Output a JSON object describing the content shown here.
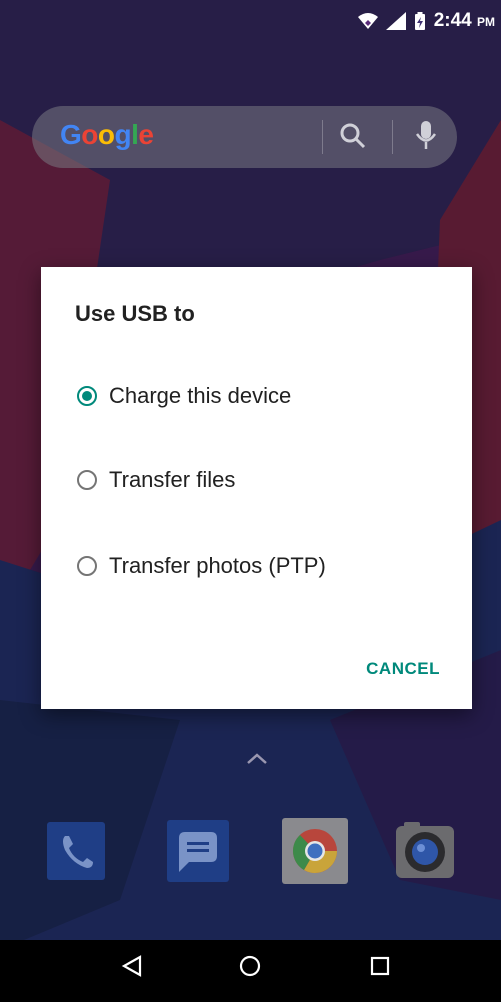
{
  "status_bar": {
    "time": "2:44",
    "ampm": "PM",
    "icons": [
      "wifi-icon",
      "cellular-signal-icon",
      "battery-charging-icon"
    ]
  },
  "search_bar": {
    "logo_text": "Google",
    "icons": [
      "search-icon",
      "mic-icon"
    ]
  },
  "dialog": {
    "title": "Use USB to",
    "options": [
      {
        "label": "Charge this device",
        "selected": true
      },
      {
        "label": "Transfer files",
        "selected": false
      },
      {
        "label": "Transfer photos (PTP)",
        "selected": false
      }
    ],
    "cancel_label": "CANCEL",
    "accent_color": "#00897b"
  },
  "dock": {
    "apps": [
      {
        "icon": "phone-icon"
      },
      {
        "icon": "messages-icon"
      },
      {
        "icon": "chrome-icon"
      },
      {
        "icon": "camera-icon"
      }
    ]
  },
  "nav_bar": {
    "buttons": [
      "back-icon",
      "home-icon",
      "recents-icon"
    ]
  }
}
